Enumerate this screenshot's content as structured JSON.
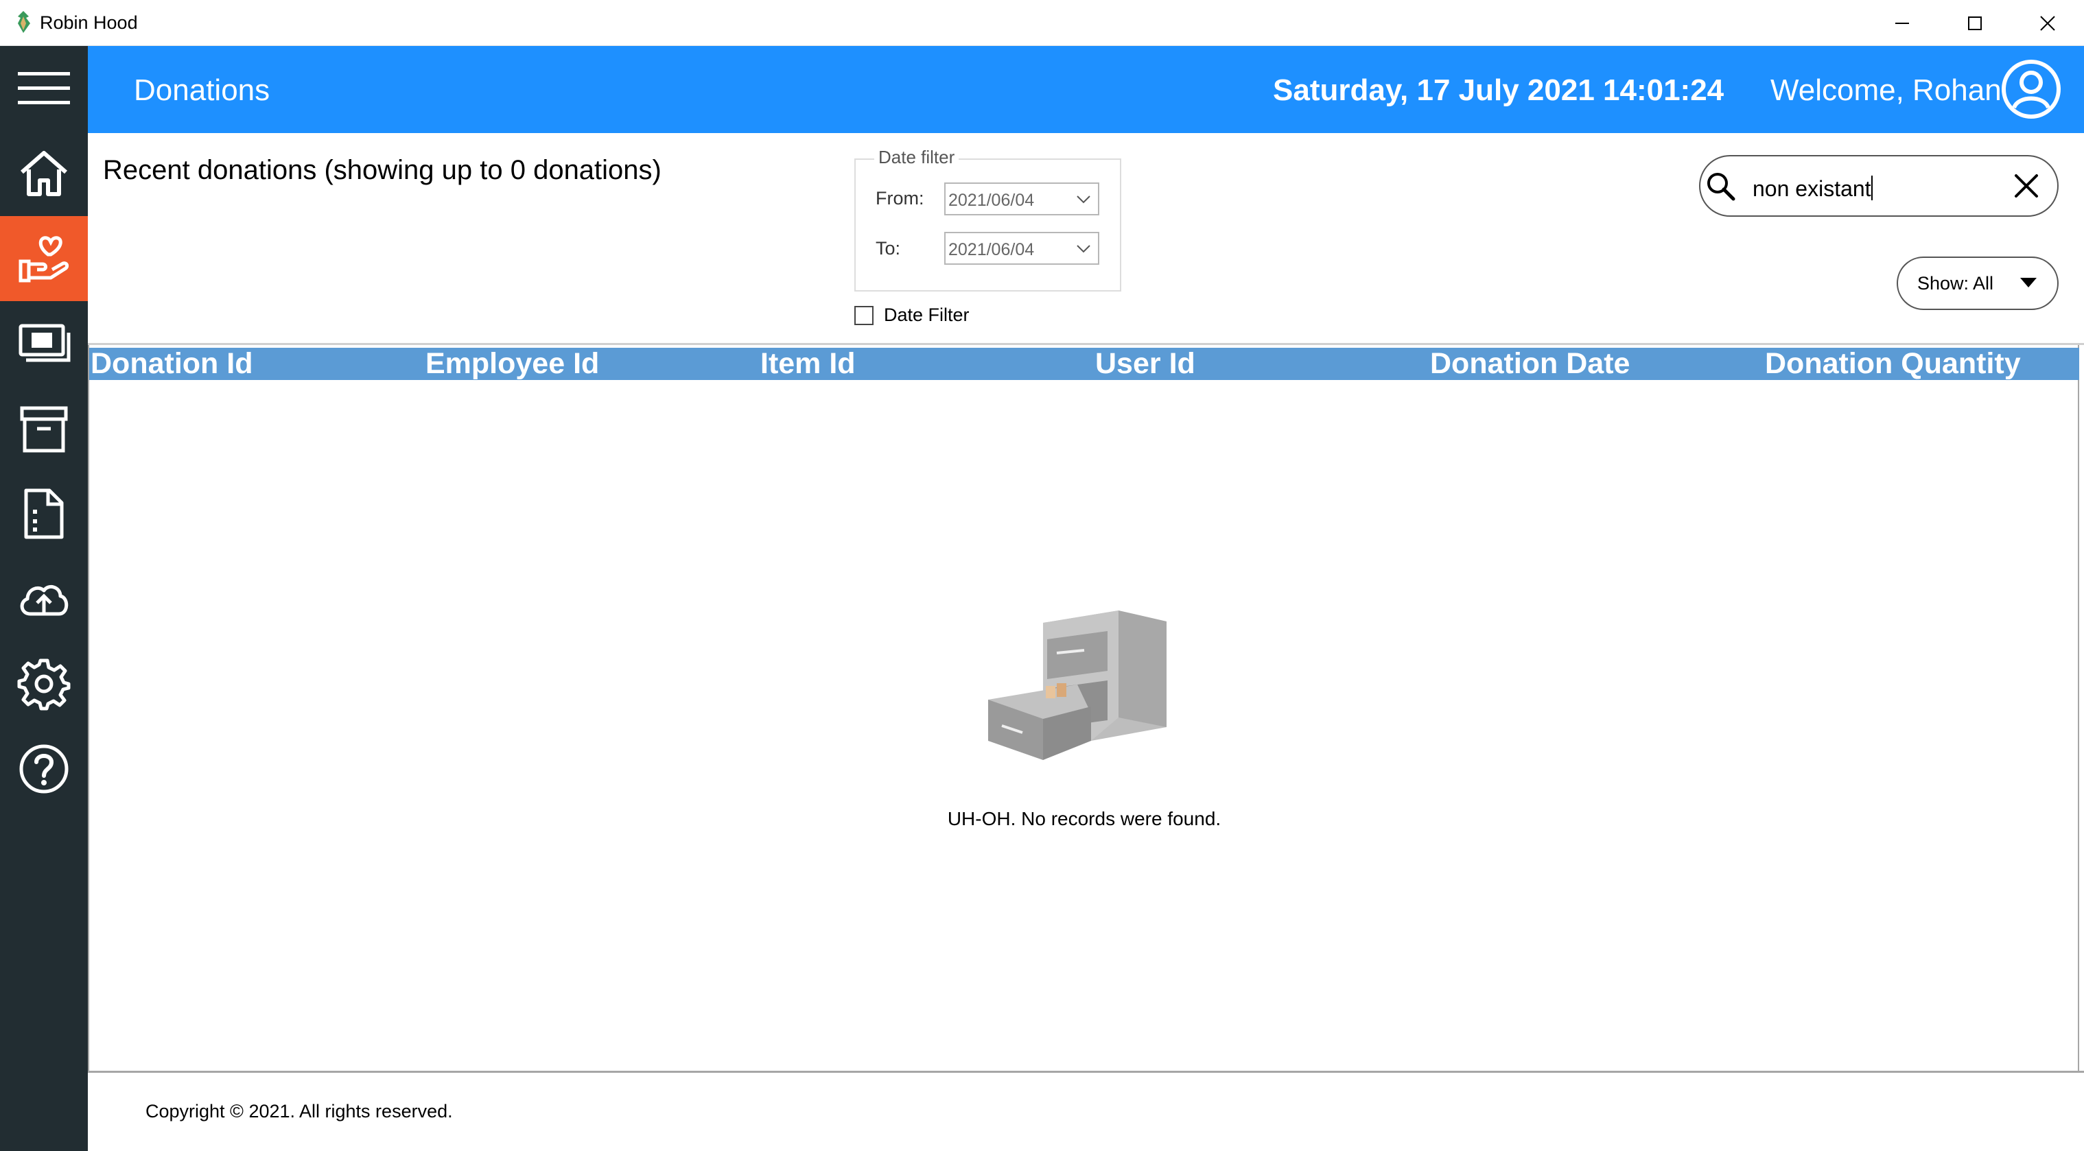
{
  "window": {
    "title": "Robin Hood",
    "controls": [
      "minimize",
      "maximize",
      "close"
    ]
  },
  "sidebar": {
    "items": [
      {
        "icon": "hamburger-menu-icon",
        "active": false
      },
      {
        "icon": "home-icon",
        "active": false
      },
      {
        "icon": "donation-hand-heart-icon",
        "active": true
      },
      {
        "icon": "cash-icon",
        "active": false
      },
      {
        "icon": "archive-icon",
        "active": false
      },
      {
        "icon": "document-icon",
        "active": false
      },
      {
        "icon": "cloud-upload-icon",
        "active": false
      },
      {
        "icon": "gear-icon",
        "active": false
      },
      {
        "icon": "help-icon",
        "active": false
      }
    ],
    "background": "#222d32",
    "active_color": "#f0592a"
  },
  "header": {
    "title": "Donations",
    "datetime": "Saturday, 17 July 2021 14:01:24",
    "welcome": "Welcome, Rohan",
    "background": "#1e90ff"
  },
  "main": {
    "recent_title": "Recent donations (showing up to 0 donations)",
    "date_filter": {
      "legend": "Date filter",
      "from_label": "From:",
      "from_value": "2021/06/04",
      "to_label": "To:",
      "to_value": "2021/06/04",
      "checkbox_label": "Date Filter",
      "checked": false
    },
    "search": {
      "value": "non existant"
    },
    "show_dropdown": {
      "selected": "Show: All"
    },
    "table": {
      "header_color": "#5b9bd5",
      "columns": [
        "Donation Id",
        "Employee Id",
        "Item Id",
        "User Id",
        "Donation Date",
        "Donation Quantity"
      ],
      "rows": []
    },
    "empty_state": {
      "message": "UH-OH. No records were found.",
      "icon": "filing-cabinet-icon"
    }
  },
  "footer": {
    "text": "Copyright © 2021. All rights reserved."
  }
}
